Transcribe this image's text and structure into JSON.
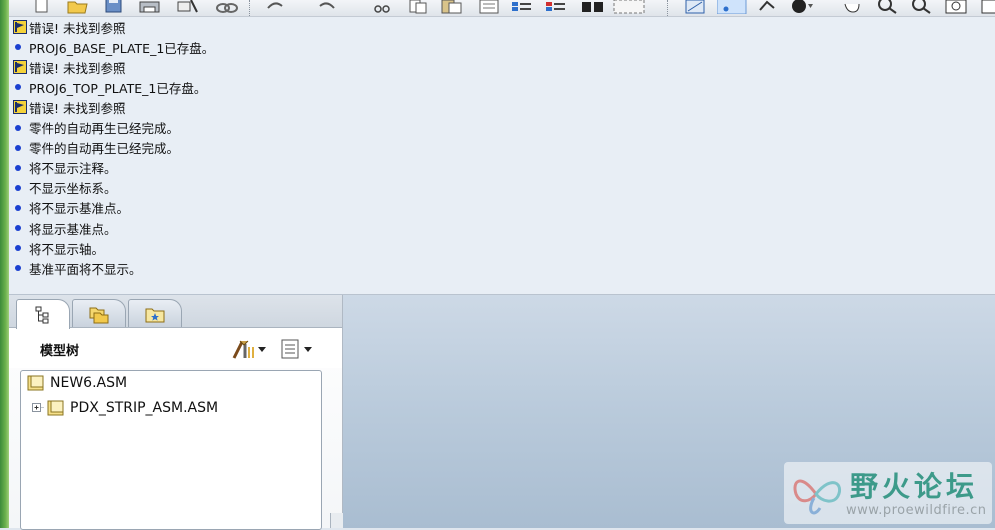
{
  "messages": [
    {
      "type": "error",
      "text": "错误! 未找到参照"
    },
    {
      "type": "info",
      "text": "PROJ6_BASE_PLATE_1已存盘。"
    },
    {
      "type": "error",
      "text": "错误! 未找到参照"
    },
    {
      "type": "info",
      "text": "PROJ6_TOP_PLATE_1已存盘。"
    },
    {
      "type": "error",
      "text": "错误! 未找到参照"
    },
    {
      "type": "info",
      "text": "零件的自动再生已经完成。"
    },
    {
      "type": "info",
      "text": "零件的自动再生已经完成。"
    },
    {
      "type": "info",
      "text": "将不显示注释。"
    },
    {
      "type": "info",
      "text": "不显示坐标系。"
    },
    {
      "type": "info",
      "text": "将不显示基准点。"
    },
    {
      "type": "info",
      "text": "将显示基准点。"
    },
    {
      "type": "info",
      "text": "将不显示轴。"
    },
    {
      "type": "info",
      "text": "基准平面将不显示。"
    }
  ],
  "model_tree": {
    "title": "模型树",
    "root": "NEW6.ASM",
    "children": [
      "PDX_STRIP_ASM.ASM"
    ]
  },
  "watermark": {
    "name": "野火论坛",
    "url": "www.proewildfire.cn"
  },
  "icons": {
    "error": "error-flag-icon",
    "info": "blue-bullet-icon"
  },
  "colors": {
    "message_bg": "#e8eef5",
    "graphics_bg": "#b9cadb",
    "bullet": "#1a3fd0",
    "watermark_text": "#3d9a8a"
  }
}
